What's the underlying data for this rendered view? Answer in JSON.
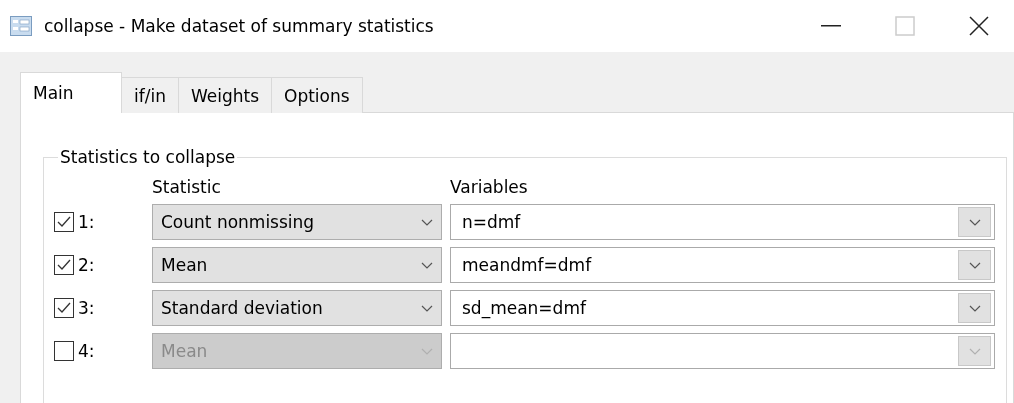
{
  "window": {
    "title": "collapse - Make dataset of summary statistics",
    "maximize_disabled": true
  },
  "tabs": [
    {
      "label": "Main",
      "selected": true
    },
    {
      "label": "if/in",
      "selected": false
    },
    {
      "label": "Weights",
      "selected": false
    },
    {
      "label": "Options",
      "selected": false
    }
  ],
  "group": {
    "legend": "Statistics to collapse",
    "columns": [
      "Statistic",
      "Variables"
    ],
    "rows": [
      {
        "number": "1:",
        "checked": true,
        "statistic": "Count nonmissing",
        "variables": "n=dmf"
      },
      {
        "number": "2:",
        "checked": true,
        "statistic": "Mean",
        "variables": "meandmf=dmf"
      },
      {
        "number": "3:",
        "checked": true,
        "statistic": "Standard deviation",
        "variables": "sd_mean=dmf"
      },
      {
        "number": "4:",
        "checked": false,
        "statistic": "Mean",
        "variables": ""
      }
    ]
  }
}
